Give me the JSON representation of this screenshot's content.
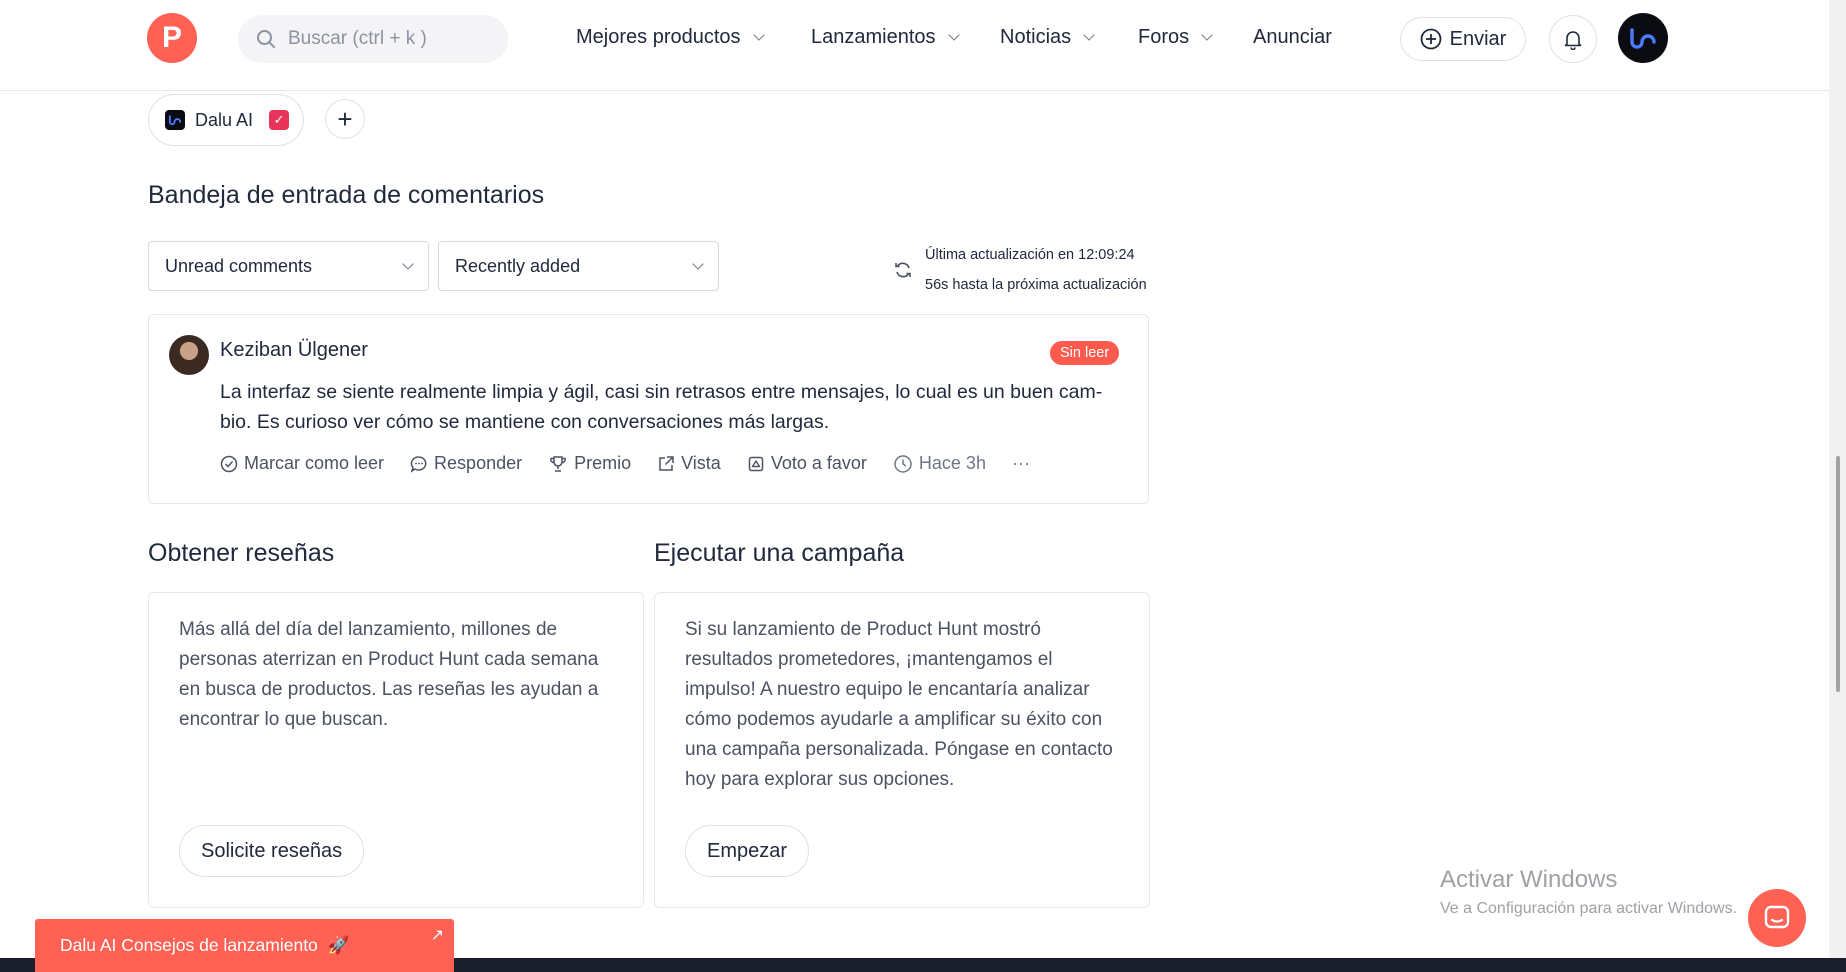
{
  "header": {
    "logo_letter": "P",
    "search_placeholder": "Buscar (ctrl + k )",
    "nav": [
      {
        "label": "Mejores productos"
      },
      {
        "label": "Lanzamientos"
      },
      {
        "label": "Noticias"
      },
      {
        "label": "Foros"
      },
      {
        "label": "Anunciar"
      }
    ],
    "send_label": "Enviar"
  },
  "product_chip": {
    "label": "Dalu AI"
  },
  "inbox": {
    "title": "Bandeja de entrada de comentarios",
    "filter_value": "Unread comments",
    "sort_value": "Recently added",
    "last_update": "Última actualización en 12:09:24",
    "next_update": "56s hasta la próxima actualización"
  },
  "comment": {
    "author": "Keziban Ülgener",
    "badge": "Sin leer",
    "text": "La interfaz se siente realmente limpia y ágil, casi sin retrasos entre mensajes, lo cual es un buen cam-bio. Es curioso ver cómo se mantiene con conversaciones más largas.",
    "actions": {
      "mark_read": "Marcar como leer",
      "reply": "Responder",
      "award": "Premio",
      "view": "Vista",
      "upvote": "Voto a favor",
      "time": "Hace 3h",
      "more": "···"
    }
  },
  "reviews": {
    "title": "Obtener reseñas",
    "body": "Más allá del día del lanzamiento, millones de personas aterrizan en Product Hunt cada semana en busca de productos. Las reseñas les ayudan a encontrar lo que buscan.",
    "button": "Solicite reseñas"
  },
  "campaign": {
    "title": "Ejecutar una campaña",
    "body": "Si su lanzamiento de Product Hunt mostró resultados prometedores, ¡mantengamos el impulso! A nuestro equipo le encantaría analizar cómo podemos ayudarle a amplificar su éxito con una campaña personalizada. Póngase en contacto hoy para explorar sus opciones.",
    "button": "Empezar"
  },
  "watermark": {
    "line1": "Activar Windows",
    "line2": "Ve a Configuración para activar Windows."
  },
  "launch_tips": {
    "label": "Dalu AI Consejos de lanzamiento"
  },
  "colors": {
    "brand": "#ff6154",
    "badge": "#ff5a4e",
    "check": "#e8345a"
  }
}
